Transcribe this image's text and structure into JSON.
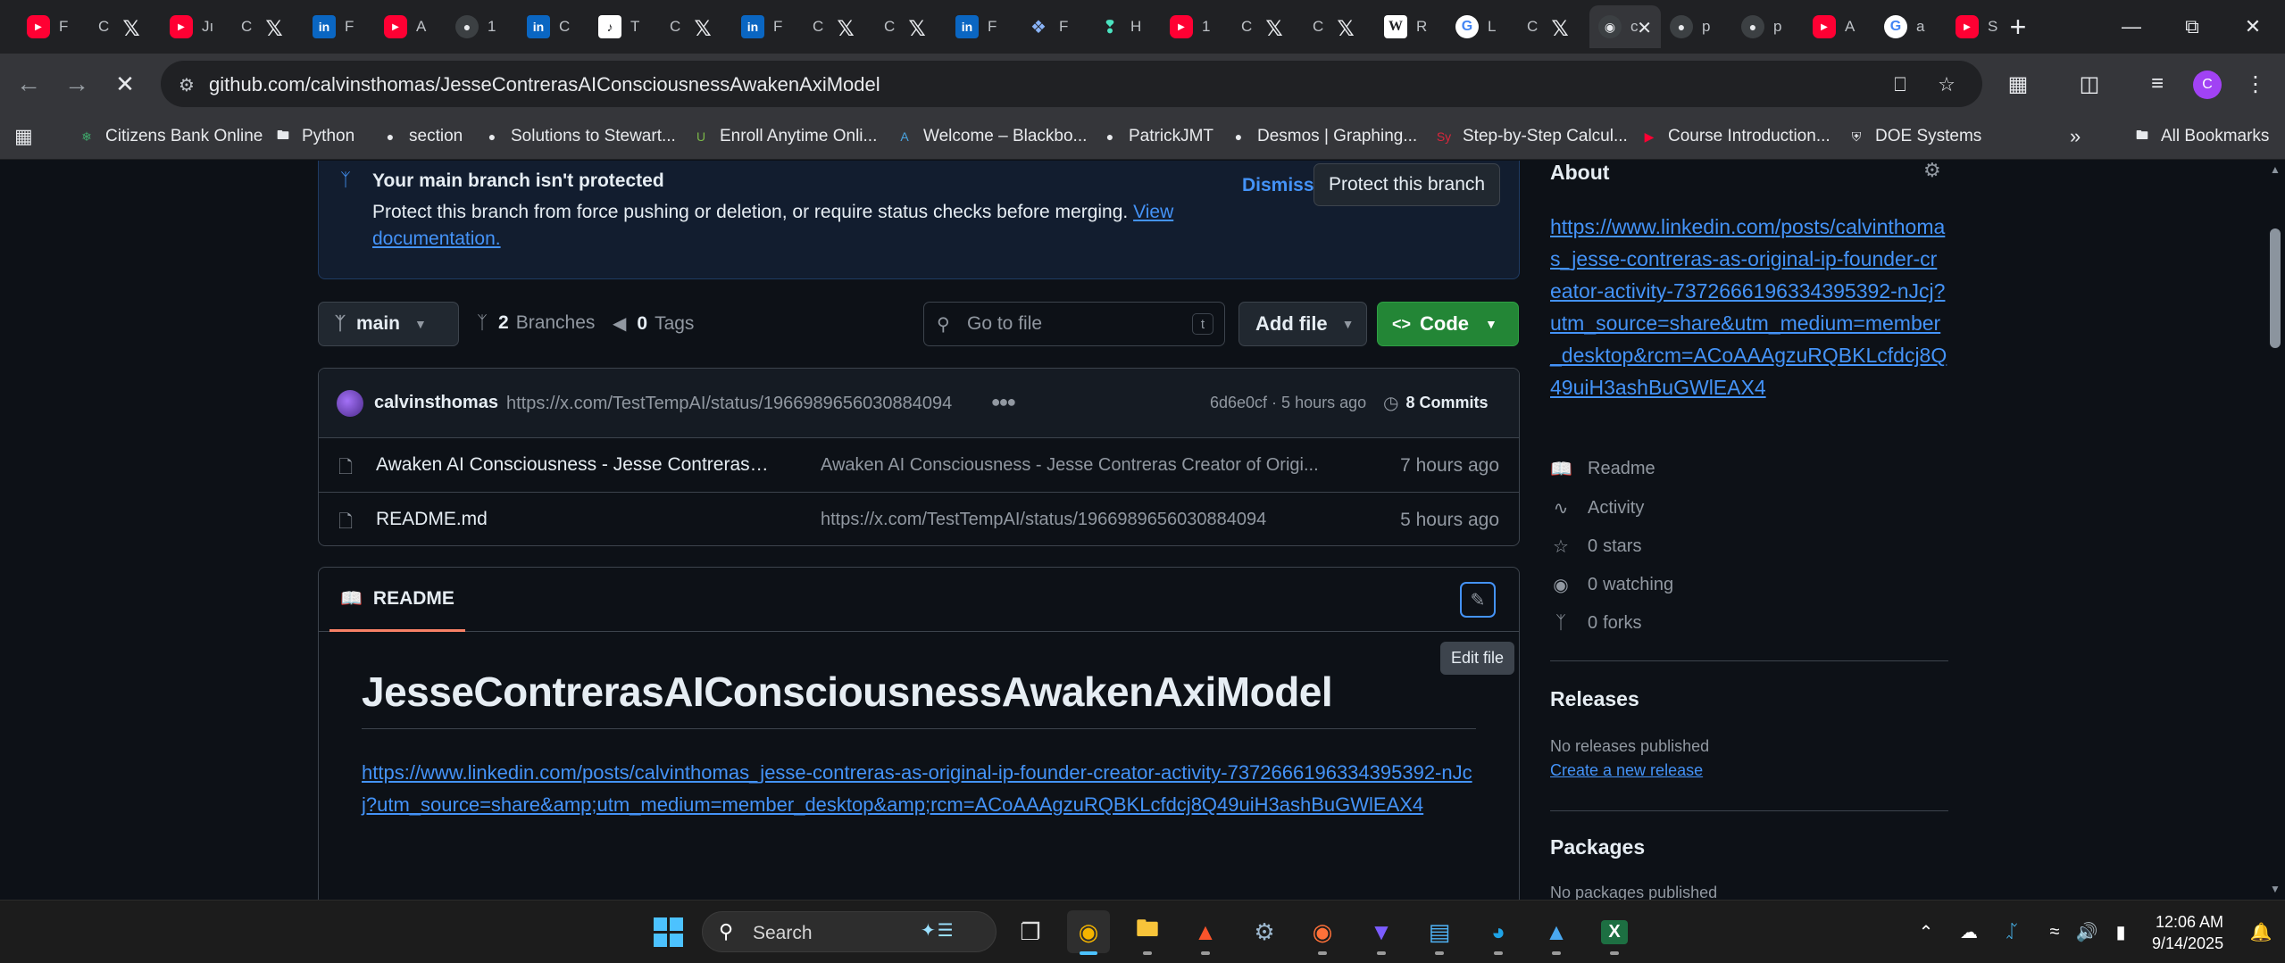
{
  "browser": {
    "tabs": [
      {
        "favicon": "youtube-icon",
        "label": "F",
        "kind": "yt"
      },
      {
        "favicon": "x-icon",
        "label": "C",
        "kind": "x"
      },
      {
        "favicon": "youtube-icon",
        "label": "Jı",
        "kind": "yt"
      },
      {
        "favicon": "x-icon",
        "label": "C",
        "kind": "x"
      },
      {
        "favicon": "linkedin-icon",
        "label": "F",
        "kind": "li"
      },
      {
        "favicon": "youtube-icon",
        "label": "A",
        "kind": "yt"
      },
      {
        "favicon": "globe-icon",
        "label": "1",
        "kind": "gl"
      },
      {
        "favicon": "linkedin-icon",
        "label": "C",
        "kind": "li"
      },
      {
        "favicon": "tiktok-icon",
        "label": "T",
        "kind": "tt"
      },
      {
        "favicon": "x-icon",
        "label": "C",
        "kind": "x"
      },
      {
        "favicon": "linkedin-icon",
        "label": "F",
        "kind": "li"
      },
      {
        "favicon": "x-icon",
        "label": "C",
        "kind": "x"
      },
      {
        "favicon": "x-icon",
        "label": "C",
        "kind": "x"
      },
      {
        "favicon": "linkedin-icon",
        "label": "F",
        "kind": "li"
      },
      {
        "favicon": "copilot-icon",
        "label": "F",
        "kind": "cp"
      },
      {
        "favicon": "hume-icon",
        "label": "H",
        "kind": "hm"
      },
      {
        "favicon": "youtube-icon",
        "label": "1",
        "kind": "yt"
      },
      {
        "favicon": "x-icon",
        "label": "C",
        "kind": "x"
      },
      {
        "favicon": "x-icon",
        "label": "C",
        "kind": "x"
      },
      {
        "favicon": "wikipedia-icon",
        "label": "R",
        "kind": "w"
      },
      {
        "favicon": "google-icon",
        "label": "L",
        "kind": "g"
      },
      {
        "favicon": "x-icon",
        "label": "C",
        "kind": "x"
      },
      {
        "favicon": "github-icon",
        "label": "c",
        "kind": "gh",
        "active": true
      },
      {
        "favicon": "globe-icon",
        "label": "p",
        "kind": "gl"
      },
      {
        "favicon": "globe-icon",
        "label": "p",
        "kind": "gl"
      },
      {
        "favicon": "youtube-icon",
        "label": "A",
        "kind": "yt"
      },
      {
        "favicon": "google-icon",
        "label": "a",
        "kind": "g"
      },
      {
        "favicon": "youtube-icon",
        "label": "S",
        "kind": "yt"
      }
    ],
    "url": "github.com/calvinsthomas/JesseContrerasAIConsciousnessAwakenAxiModel",
    "profile_initial": "C",
    "bookmarks": [
      {
        "label": "Citizens Bank Online",
        "icon": "citizens-bank-icon",
        "color": "#3fa86b"
      },
      {
        "label": "Python",
        "icon": "folder-icon",
        "color": "#e8eaed"
      },
      {
        "label": "section",
        "icon": "globe-icon",
        "color": "#e8eaed"
      },
      {
        "label": "Solutions to Stewart...",
        "icon": "globe-icon",
        "color": "#e8eaed"
      },
      {
        "label": "Enroll Anytime Onli...",
        "icon": "uo-icon",
        "color": "#7ab648"
      },
      {
        "label": "Welcome – Blackbo...",
        "icon": "blackboard-icon",
        "color": "#4aa3df"
      },
      {
        "label": "PatrickJMT",
        "icon": "globe-icon",
        "color": "#e8eaed"
      },
      {
        "label": "Desmos | Graphing...",
        "icon": "globe-icon",
        "color": "#e8eaed"
      },
      {
        "label": "Step-by-Step Calcul...",
        "icon": "symbolab-icon",
        "color": "#d9263b"
      },
      {
        "label": "Course Introduction...",
        "icon": "youtube-icon",
        "color": "#ff0033"
      },
      {
        "label": "DOE Systems",
        "icon": "shield-icon",
        "color": "#e8eaed"
      }
    ],
    "all_bookmarks_label": "All Bookmarks"
  },
  "banner": {
    "title": "Your main branch isn't protected",
    "text": "Protect this branch from force pushing or deletion, or require status checks before merging.",
    "link": "View documentation.",
    "dismiss": "Dismiss",
    "protect": "Protect this branch"
  },
  "repo": {
    "branch": "main",
    "branches_count": "2",
    "branches_label": "Branches",
    "tags_count": "0",
    "tags_label": "Tags",
    "goto_placeholder": "Go to file",
    "goto_key": "t",
    "add_file": "Add file",
    "code": "Code"
  },
  "commit": {
    "user": "calvinsthomas",
    "message": "https://x.com/TestTempAI/status/1966989656030884094",
    "hash_time": "6d6e0cf · 5 hours ago",
    "commits_count": "8",
    "commits_label": "Commits"
  },
  "files": [
    {
      "name": "Awaken AI Consciousness - Jesse Contreras Cr...",
      "message": "Awaken AI Consciousness - Jesse Contreras Creator of Origi...",
      "time": "7 hours ago"
    },
    {
      "name": "README.md",
      "message": "https://x.com/TestTempAI/status/1966989656030884094",
      "time": "5 hours ago"
    }
  ],
  "readme": {
    "tab": "README",
    "edit_tooltip": "Edit file",
    "title": "JesseContrerasAIConsciousnessAwakenAxiModel",
    "link": "https://www.linkedin.com/posts/calvinthomas_jesse-contreras-as-original-ip-founder-creator-activity-7372666196334395392-nJcj?utm_source=share&amp;utm_medium=member_desktop&amp;rcm=ACoAAAgzuRQBKLcfdcj8Q49uiH3ashBuGWlEAX4"
  },
  "about": {
    "heading": "About",
    "link": "https://www.linkedin.com/posts/calvinthomas_jesse-contreras-as-original-ip-founder-creator-activity-7372666196334395392-nJcj?utm_source=share&utm_medium=member_desktop&rcm=ACoAAAgzuRQBKLcfdcj8Q49uiH3ashBuGWlEAX4",
    "readme": "Readme",
    "activity": "Activity",
    "stars_count": "0",
    "stars_label": "stars",
    "watching_count": "0",
    "watching_label": "watching",
    "forks_count": "0",
    "forks_label": "forks"
  },
  "releases": {
    "heading": "Releases",
    "none": "No releases published",
    "create": "Create a new release"
  },
  "packages": {
    "heading": "Packages",
    "none": "No packages published"
  },
  "taskbar": {
    "search_placeholder": "Search",
    "apps": [
      "task-view-icon",
      "chrome-icon",
      "file-explorer-icon",
      "brave-icon",
      "settings-icon",
      "firefox-icon",
      "vpn-icon",
      "notepad-icon",
      "edge-icon",
      "photos-icon",
      "excel-icon"
    ],
    "time": "12:06 AM",
    "date": "9/14/2025"
  },
  "colors": {
    "accent_link": "#4493f8",
    "code_button": "#238636",
    "page_bg": "#0d1117"
  }
}
